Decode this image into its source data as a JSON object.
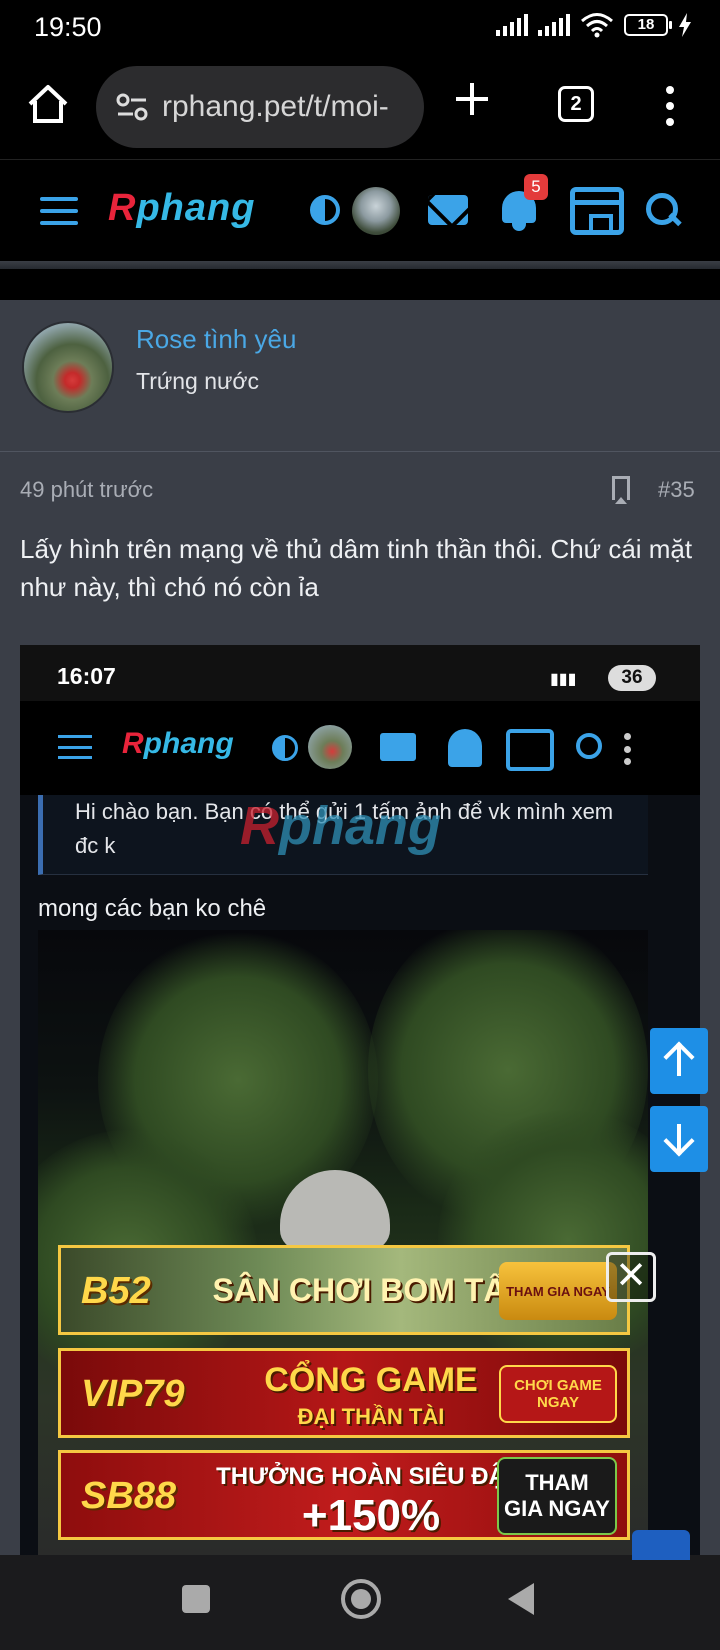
{
  "status_bar": {
    "time": "19:50",
    "battery": "18"
  },
  "browser": {
    "url": "rphang.pet/t/moi-",
    "tab_count": "2"
  },
  "site_header": {
    "logo_r": "R",
    "logo_rest": "phang",
    "notification_count": "5"
  },
  "post": {
    "author": {
      "name": "Rose tình yêu",
      "title": "Trứng nước"
    },
    "time_ago": "49 phút trước",
    "number": "#35",
    "text": "Lấy hình trên mạng về thủ dâm tinh thần thôi. Chứ cái mặt như này, thì chó nó còn ỉa"
  },
  "embedded_screenshot": {
    "time": "16:07",
    "battery": "36",
    "logo_r": "R",
    "logo_rest": "phang",
    "quote": "Hi chào bạn. Bạn có thể gửi 1 tấm ảnh để vk mình xem đc k",
    "caption": "mong các bạn ko chê"
  },
  "ads": [
    {
      "brand": "B52",
      "main_line1": "SÂN CHƠI BOM TẤN",
      "main_line2": "",
      "cta": "THAM GIA NGAY"
    },
    {
      "brand": "VIP79",
      "main_line1": "CỔNG GAME",
      "main_line2": "ĐẠI THẦN TÀI",
      "cta": "CHƠI GAME NGAY"
    },
    {
      "brand": "SB88",
      "main_line1": "THƯỞNG HOÀN SIÊU ĐẬM",
      "main_line2": "+150%",
      "cta": "THAM GIA NGAY"
    }
  ],
  "ad_close_label": "✕",
  "icons": {
    "home": "home-icon",
    "site_info": "site-info-icon",
    "new_tab": "plus-icon",
    "menu": "more-vert-icon",
    "hamburger": "hamburger-icon",
    "theme": "contrast-icon",
    "mail": "mail-icon",
    "bell": "bell-icon",
    "store": "store-icon",
    "search": "search-icon",
    "bookmark": "bookmark-icon",
    "scroll_up": "arrow-up-icon",
    "scroll_down": "arrow-down-icon"
  },
  "colors": {
    "accent": "#3ba3e8",
    "post_bg": "#3a3e47",
    "logo_red": "#e8243b",
    "logo_blue": "#36b9e6",
    "badge": "#e33b3b"
  }
}
